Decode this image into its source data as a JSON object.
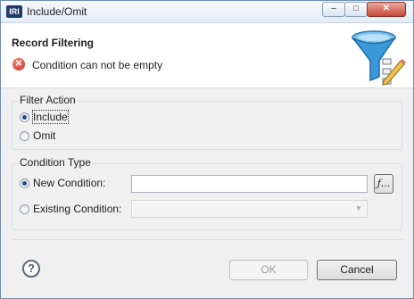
{
  "window": {
    "app_icon": "IRI",
    "title": "Include/Omit"
  },
  "titlebar_buttons": {
    "minimize": "–",
    "maximize": "□",
    "close": "✕"
  },
  "header": {
    "title": "Record Filtering",
    "error_icon": "✕",
    "error_message": "Condition can not be empty",
    "banner_icon": "funnel-icon"
  },
  "filter_action": {
    "label": "Filter Action",
    "options": [
      {
        "label": "Include",
        "selected": true
      },
      {
        "label": "Omit",
        "selected": false
      }
    ]
  },
  "condition_type": {
    "label": "Condition Type",
    "new_condition": {
      "label": "New Condition:",
      "selected": true,
      "value": ""
    },
    "function_button": "ƒ...",
    "existing_condition": {
      "label": "Existing Condition:",
      "selected": false,
      "value": ""
    }
  },
  "footer": {
    "help": "?",
    "ok": "OK",
    "cancel": "Cancel"
  },
  "colors": {
    "error": "#d3271b",
    "radio_dot": "#1f4c8f",
    "title_bar": "#e3ecf7"
  }
}
